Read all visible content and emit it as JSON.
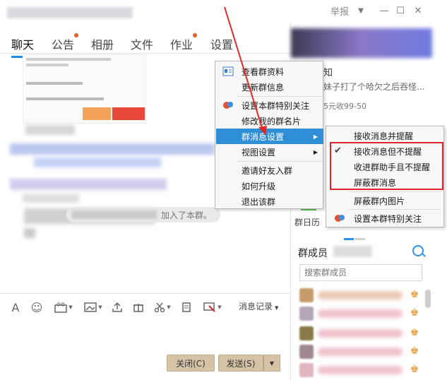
{
  "titlebar": {
    "report_label": "举报",
    "chevron": "▼",
    "minimize": "—",
    "maximize": "☐",
    "close": "✕"
  },
  "tabs": [
    {
      "label": "聊天",
      "active": true,
      "dot": false
    },
    {
      "label": "公告",
      "active": false,
      "dot": true
    },
    {
      "label": "相册",
      "active": false,
      "dot": false
    },
    {
      "label": "文件",
      "active": false,
      "dot": false
    },
    {
      "label": "作业",
      "active": false,
      "dot": true
    },
    {
      "label": "设置",
      "active": false,
      "dot": false
    }
  ],
  "chat": {
    "recall_text": "加入了本群。"
  },
  "toolbar": {
    "font_icon": "A",
    "emoji_icon": "☺",
    "message_log": "消息记录"
  },
  "buttons": {
    "close_label": "关闭(C)",
    "send_label": "发送(S)"
  },
  "right_panel": {
    "notice_title": "群通知",
    "notice_text": "妹子打了个哈欠之后吞怪...",
    "notice_price": "5元收99-50",
    "calendar_label": "群日历",
    "members_label": "群成员",
    "member_search_placeholder": "搜索群成员"
  },
  "context_menu": {
    "items": [
      {
        "label": "查看群资料"
      },
      {
        "label": "更新群信息"
      },
      {
        "label": "设置本群特别关注"
      },
      {
        "label": "修改我的群名片"
      },
      {
        "label": "群消息设置",
        "highlighted": true,
        "submenu": true
      },
      {
        "label": "视图设置",
        "submenu": true
      },
      {
        "label": "邀请好友入群"
      },
      {
        "label": "如何升级"
      },
      {
        "label": "退出该群"
      }
    ]
  },
  "sub_menu": {
    "items": [
      {
        "label": "接收消息并提醒",
        "checked": false
      },
      {
        "label": "接收消息但不提醒",
        "checked": true
      },
      {
        "label": "收进群助手且不提醒",
        "checked": false
      },
      {
        "label": "屏蔽群消息",
        "checked": false
      },
      {
        "label": "屏蔽群内图片",
        "checked": false
      },
      {
        "label": "设置本群特别关注",
        "checked": false
      }
    ]
  },
  "colors": {
    "accent": "#2f8fd6",
    "highlight_box": "#d9262b",
    "send_button": "#d6c3a5"
  }
}
